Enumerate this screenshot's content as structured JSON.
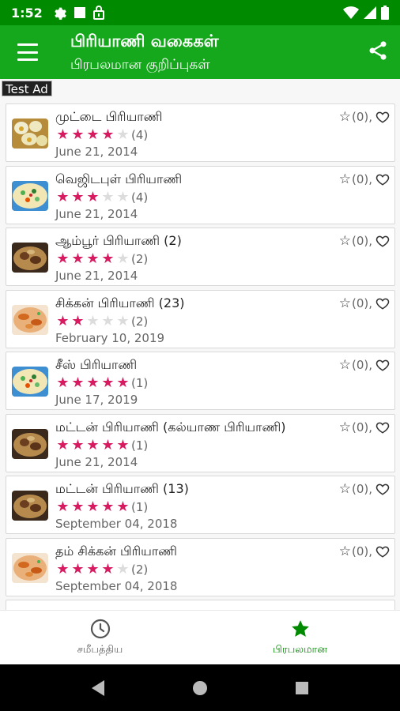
{
  "status_bar": {
    "time": "1:52"
  },
  "app_bar": {
    "title": "பிரியாணி வகைகள்",
    "subtitle": "பிரபலமான குறிப்புகள்"
  },
  "ad": {
    "label": "Test Ad"
  },
  "colors": {
    "status_bar": "#008a00",
    "app_bar": "#16a81c",
    "star_on": "#d81b60",
    "star_off": "#dcdcdc",
    "nav_active": "#008a00"
  },
  "recipes": [
    {
      "title": "முட்டை பிரியாணி",
      "rating": 4,
      "count": "(4)",
      "date": "June 21, 2014",
      "fav": "(0),",
      "image": "egg-biryani"
    },
    {
      "title": "வெஜிடபுள் பிரியாணி",
      "rating": 3,
      "count": "(4)",
      "date": "June 21, 2014",
      "fav": "(0),",
      "image": "vegetable-biryani"
    },
    {
      "title": "ஆம்பூர் பிரியாணி (2)",
      "rating": 4,
      "count": "(2)",
      "date": "June 21, 2014",
      "fav": "(0),",
      "image": "mutton-biryani"
    },
    {
      "title": "சிக்கன் பிரியாணி (23)",
      "rating": 2,
      "count": "(2)",
      "date": "February 10, 2019",
      "fav": "(0),",
      "image": "chicken-biryani"
    },
    {
      "title": "சீஸ் பிரியாணி",
      "rating": 5,
      "count": "(1)",
      "date": "June 17, 2019",
      "fav": "(0),",
      "image": "vegetable-biryani"
    },
    {
      "title": "மட்டன் பிரியாணி (கல்யாண பிரியாணி)",
      "rating": 5,
      "count": "(1)",
      "date": "June 21, 2014",
      "fav": "(0),",
      "image": "mutton-biryani"
    },
    {
      "title": "மட்டன் பிரியாணி (13)",
      "rating": 5,
      "count": "(1)",
      "date": "September 04, 2018",
      "fav": "(0),",
      "image": "mutton-biryani"
    },
    {
      "title": "தம் சிக்கன் பிரியாணி",
      "rating": 4,
      "count": "(2)",
      "date": "September 04, 2018",
      "fav": "(0),",
      "image": "chicken-biryani"
    }
  ],
  "bottom_nav": [
    {
      "label": "சமீபத்திய",
      "icon": "clock-icon",
      "active": false
    },
    {
      "label": "பிரபலமான",
      "icon": "star-icon",
      "active": true
    }
  ]
}
